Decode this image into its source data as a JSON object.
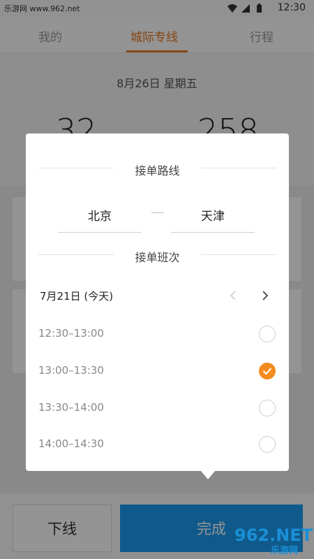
{
  "status": {
    "site_badge": "乐游网 www.962.net",
    "time": "12:30"
  },
  "tabs": [
    {
      "label": "我的"
    },
    {
      "label": "城际专线"
    },
    {
      "label": "行程"
    }
  ],
  "page": {
    "date": "8月26日  星期五",
    "stat_left": "32",
    "stat_right": "258"
  },
  "modal": {
    "route_title": "接单路线",
    "from_city": "北京",
    "to_city": "天津",
    "schedule_title": "接单班次",
    "date_label": "7月21日 (今天)",
    "slots": [
      {
        "label": "12:30–13:00",
        "checked": false
      },
      {
        "label": "13:00–13:30",
        "checked": true
      },
      {
        "label": "13:30–14:00",
        "checked": false
      },
      {
        "label": "14:00–14:30",
        "checked": false
      }
    ]
  },
  "bottom": {
    "offline_label": "下线",
    "done_label": "完成"
  },
  "watermark": {
    "logo": "962",
    "suffix": ".NET",
    "sub": "乐游网"
  },
  "colors": {
    "accent_orange": "#f38b1d",
    "primary_blue": "#1d9cf0"
  }
}
